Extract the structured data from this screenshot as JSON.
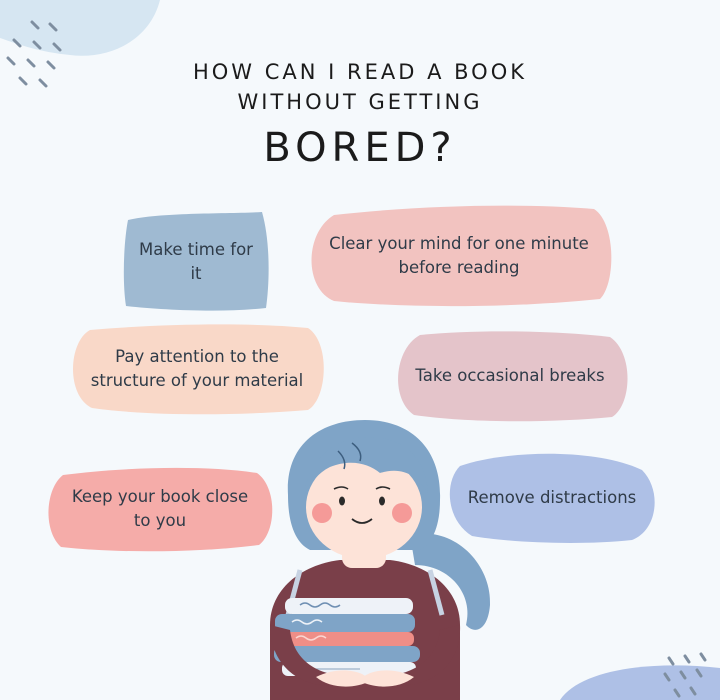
{
  "title": {
    "line1": "HOW CAN I READ A BOOK",
    "line2": "WITHOUT GETTING",
    "line3": "BORED?"
  },
  "tips": [
    {
      "text": "Make time for it",
      "color": "#9fbad2"
    },
    {
      "text": "Clear your mind for one minute before reading",
      "color": "#f2c3c0"
    },
    {
      "text": "Pay attention to the structure of your material",
      "color": "#f9d8c8"
    },
    {
      "text": "Take occasional breaks",
      "color": "#e4c4ca"
    },
    {
      "text": "Keep your book close to you",
      "color": "#f5aca9"
    },
    {
      "text": "Remove distractions",
      "color": "#aec0e6"
    }
  ],
  "colors": {
    "background": "#f5f9fc",
    "hair": "#7fa4c7",
    "shirt": "#7a3f49",
    "skin": "#fde3d8",
    "cheek": "#f59a98"
  }
}
